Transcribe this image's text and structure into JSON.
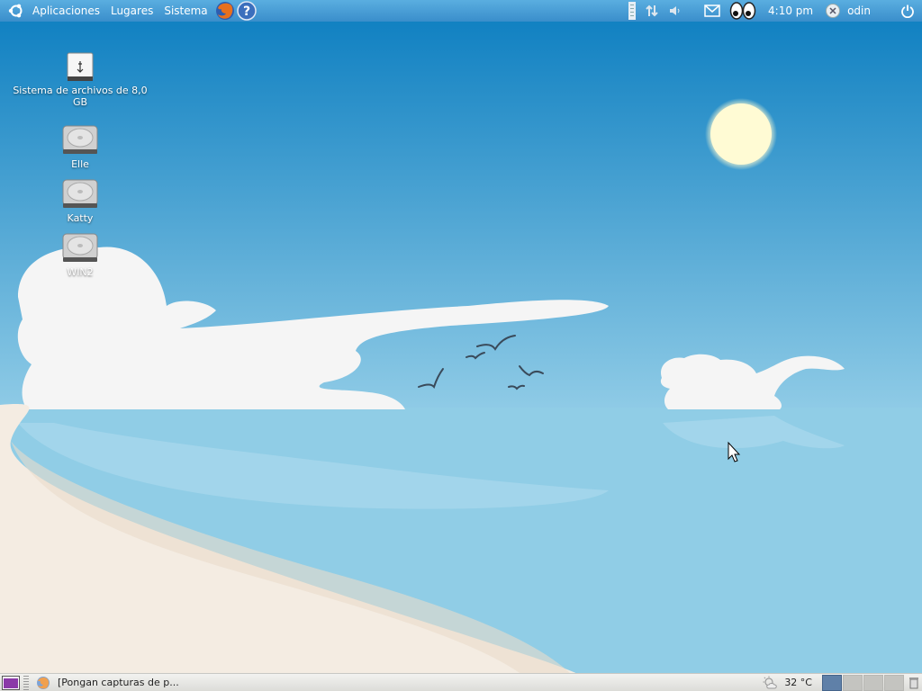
{
  "top_panel": {
    "menus": [
      "Aplicaciones",
      "Lugares",
      "Sistema"
    ],
    "clock": "4:10 pm",
    "user": "odin",
    "launchers": [
      "firefox-icon",
      "help-icon"
    ],
    "tray": [
      "network-icon",
      "volume-icon",
      "mail-icon",
      "eyes-applet-icon"
    ]
  },
  "desktop": {
    "icons": [
      {
        "label": "Sistema de archivos de 8,0 GB",
        "icon": "usb-drive-icon"
      },
      {
        "label": "Elle",
        "icon": "hard-drive-icon"
      },
      {
        "label": "Katty",
        "icon": "hard-drive-icon"
      },
      {
        "label": "WIN2",
        "icon": "hard-drive-icon"
      }
    ]
  },
  "bottom_panel": {
    "task": "[Pongan capturas de p...",
    "weather": "32 °C",
    "workspaces": 4,
    "active_workspace": 1
  },
  "colors": {
    "sky_top": "#0a7dc0",
    "sky_bottom": "#8fcbe6",
    "sea": "#90cde6",
    "sand": "#f4ece2",
    "panel_blue": "#3a8ecb"
  }
}
